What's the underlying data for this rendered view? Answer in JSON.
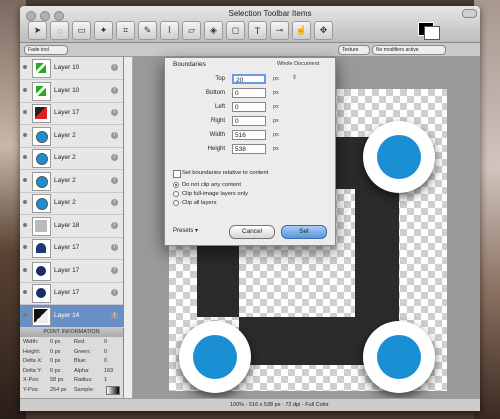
{
  "window": {
    "title": "Selection Toolbar Items"
  },
  "toolbar": {
    "tools": [
      "arrow-icon",
      "lasso-icon",
      "marquee-icon",
      "magic-wand-icon",
      "crop-icon",
      "pencil-icon",
      "brush-icon",
      "eraser-icon",
      "fill-icon",
      "shape-icon",
      "text-icon",
      "eyedropper-icon",
      "smudge-icon",
      "move-icon"
    ],
    "colors": {
      "foreground": "#000000",
      "background": "#ffffff"
    }
  },
  "options_bar": {
    "left_label": "Fade tool",
    "texture_label": "Texture",
    "modifier_label": "No modifiers active"
  },
  "layers": [
    {
      "name": "Layer 10",
      "selected": false
    },
    {
      "name": "Layer 10",
      "selected": false
    },
    {
      "name": "Layer 17",
      "selected": false
    },
    {
      "name": "Layer 2",
      "selected": false
    },
    {
      "name": "Layer 2",
      "selected": false
    },
    {
      "name": "Layer 2",
      "selected": false
    },
    {
      "name": "Layer 2",
      "selected": false
    },
    {
      "name": "Layer 18",
      "selected": false
    },
    {
      "name": "Layer 17",
      "selected": false
    },
    {
      "name": "Layer 17",
      "selected": false
    },
    {
      "name": "Layer 17",
      "selected": false
    },
    {
      "name": "Layer 14",
      "selected": true
    }
  ],
  "point_info": {
    "header": "POINT INFORMATION",
    "left": [
      {
        "label": "Width:",
        "value": "0 px"
      },
      {
        "label": "Height:",
        "value": "0 px"
      },
      {
        "label": "Delta X:",
        "value": "0 px"
      },
      {
        "label": "Delta Y:",
        "value": "0 px"
      },
      {
        "label": "X-Pos:",
        "value": "58 px"
      },
      {
        "label": "Y-Pos:",
        "value": "254 px"
      }
    ],
    "right": [
      {
        "label": "Red:",
        "value": "0"
      },
      {
        "label": "Green:",
        "value": "0"
      },
      {
        "label": "Blue:",
        "value": "0"
      },
      {
        "label": "Alpha:",
        "value": "169"
      },
      {
        "label": "Radius:",
        "value": "1"
      },
      {
        "label": "Sample:",
        "value": ""
      }
    ]
  },
  "status": {
    "text": "100% - 516 x 538 px - 72 dpi - Full Color"
  },
  "dialog": {
    "title": "Boundaries",
    "subtitle": "Whole Document",
    "fields": [
      {
        "label": "Top",
        "value": "20",
        "unit": "px"
      },
      {
        "label": "Bottom",
        "value": "0",
        "unit": "px"
      },
      {
        "label": "Left",
        "value": "0",
        "unit": "px"
      },
      {
        "label": "Right",
        "value": "0",
        "unit": "px"
      },
      {
        "label": "Width",
        "value": "516",
        "unit": "px"
      },
      {
        "label": "Height",
        "value": "538",
        "unit": "px"
      }
    ],
    "relative_checkbox": "Set boundaries relative to content",
    "clip_options": [
      "Do not clip any content",
      "Clip full-image layers only",
      "Clip all layers"
    ],
    "clip_selected": 0,
    "presets_label": "Presets",
    "cancel_label": "Cancel",
    "set_label": "Set"
  },
  "canvas": {
    "circle_color": "#1b8fd4",
    "shape_color": "#2b2b2b"
  }
}
